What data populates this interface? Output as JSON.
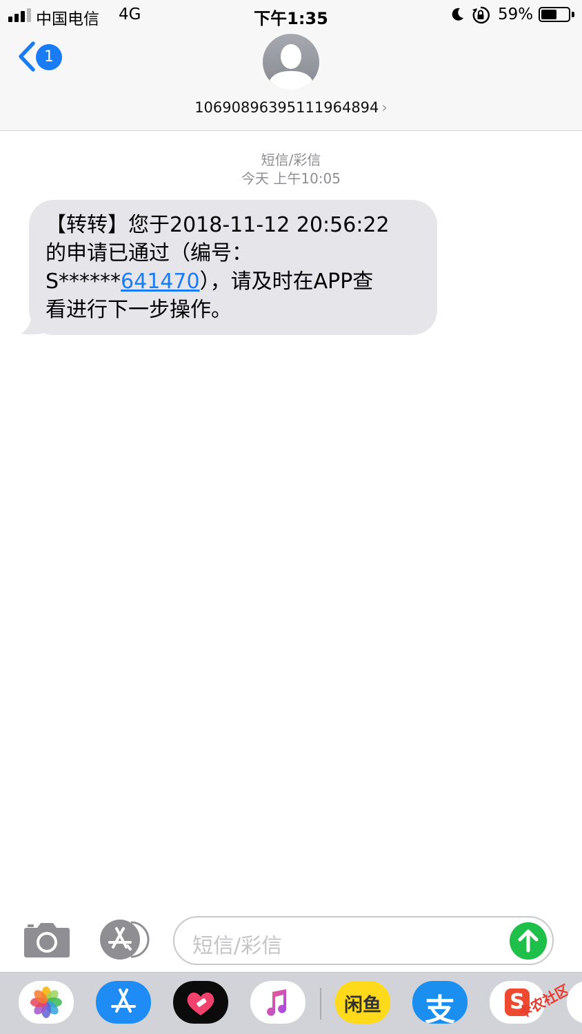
{
  "status_bar": {
    "carrier": "中国电信",
    "network": "4G",
    "time": "下午1:35",
    "battery_percent": "59%",
    "battery_level": 0.59
  },
  "header": {
    "back_badge": "1",
    "sender": "106908963951119648 94",
    "sender_chevron": "›"
  },
  "thread": {
    "type_label": "短信/彩信",
    "timestamp": "今天 上午10:05",
    "message": {
      "line1": "【转转】您于2018-11-12 20:56:22",
      "line2": "的申请已通过（编号：",
      "line3_prefix": "S******",
      "line3_link": "641470",
      "line3_suffix": "），请及时在APP查",
      "line4": "看进行下一步操作。"
    }
  },
  "input_bar": {
    "placeholder": "短信/彩信"
  },
  "app_drawer": {
    "apps": [
      {
        "name": "photos-app-icon"
      },
      {
        "name": "app-store-app-icon"
      },
      {
        "name": "heart-sticker-app-icon"
      },
      {
        "name": "music-app-icon"
      },
      {
        "name": "xianyu-app-icon",
        "label": "闲鱼"
      },
      {
        "name": "alipay-app-icon",
        "label": "支"
      },
      {
        "name": "sogou-app-icon",
        "label": "S"
      }
    ],
    "watermark": "卡农社区"
  },
  "colors": {
    "accent": "#1a7cf5",
    "bubble": "#e5e5ea",
    "send": "#1fc04a",
    "bar": "#f7f7f7"
  }
}
